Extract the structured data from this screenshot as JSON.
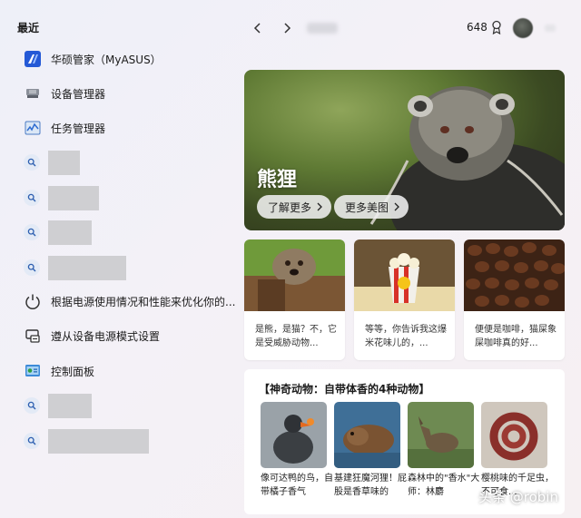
{
  "left": {
    "section_title": "最近",
    "items": [
      {
        "label": "华硕管家（MyASUS）",
        "icon": "myasus-icon"
      },
      {
        "label": "设备管理器",
        "icon": "device-manager-icon"
      },
      {
        "label": "任务管理器",
        "icon": "task-manager-icon"
      },
      {
        "label": "根据电源使用情况和性能来优化你的...",
        "icon": "power-icon"
      },
      {
        "label": "遵从设备电源模式设置",
        "icon": "power-settings-icon"
      },
      {
        "label": "控制面板",
        "icon": "control-panel-icon"
      }
    ]
  },
  "topbar": {
    "points": "648"
  },
  "hero": {
    "title": "熊狸",
    "learn_more": "了解更多",
    "more_images": "更多美图"
  },
  "cards": [
    {
      "text": "是熊，是猫？不，它是受威胁动物..."
    },
    {
      "text": "等等，你告诉我这爆米花味儿的，..."
    },
    {
      "text": "便便是咖啡，猫屎象屎咖啡真的好..."
    }
  ],
  "bottom": {
    "title": "【神奇动物：自带体香的4种动物】",
    "tiles": [
      {
        "caption": "像可达鸭的鸟，自带橘子香气"
      },
      {
        "caption": "基建狂魔河狸！屁股是香草味的"
      },
      {
        "caption": "森林中的\"香水\"大师：林麝"
      },
      {
        "caption": "樱桃味的千足虫，不可食..."
      }
    ]
  },
  "watermark": "头条 @robin"
}
